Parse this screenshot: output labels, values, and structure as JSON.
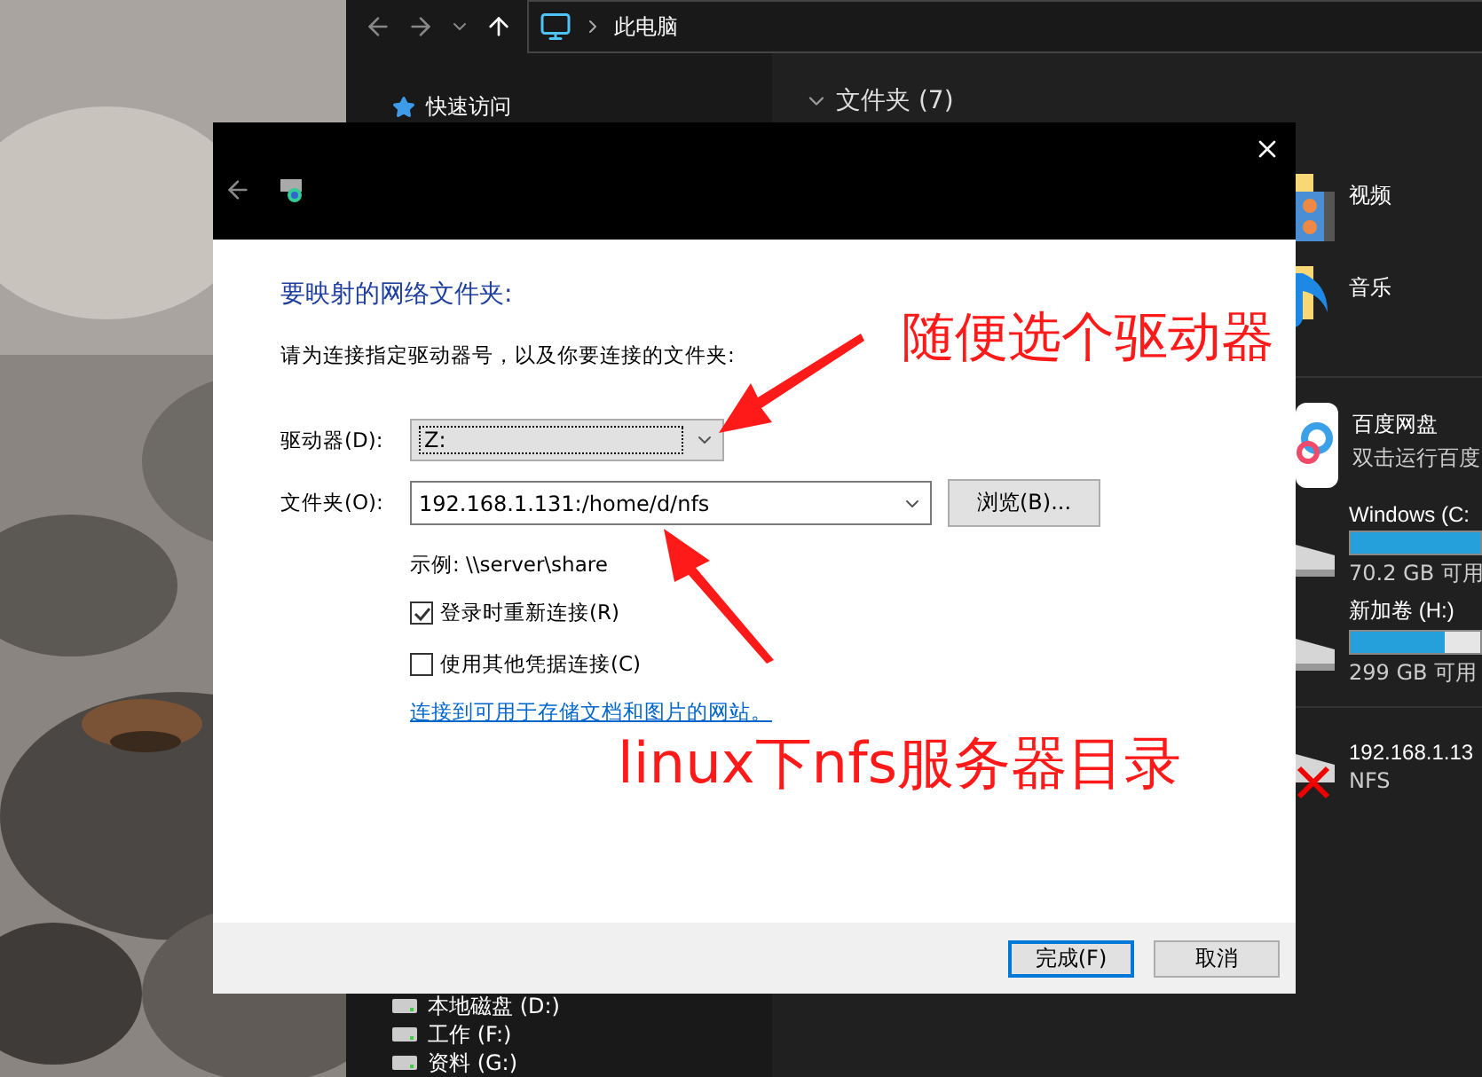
{
  "explorer": {
    "address": "此电脑",
    "nav_top": [
      {
        "label": "快速访问",
        "kind": "star"
      }
    ],
    "nav_bottom": [
      {
        "label": "本地磁盘 (D:)",
        "kind": "drive"
      },
      {
        "label": "工作 (F:)",
        "kind": "drive"
      },
      {
        "label": "资料 (G:)",
        "kind": "drive"
      }
    ],
    "section_header": "文件夹 (7)",
    "items": [
      {
        "kind": "video",
        "name": "视频"
      },
      {
        "kind": "music",
        "name": "音乐"
      },
      {
        "kind": "divider"
      },
      {
        "kind": "app",
        "name": "百度网盘",
        "detail": "双击运行百度"
      },
      {
        "kind": "disk",
        "name": "Windows (C:",
        "level": 1,
        "detail": "70.2 GB 可用"
      },
      {
        "kind": "disk",
        "name": "新加卷 (H:)",
        "level": 0.73,
        "detail": "299 GB 可用"
      },
      {
        "kind": "divider"
      },
      {
        "kind": "network",
        "name": "192.168.1.13",
        "detail": "NFS"
      }
    ]
  },
  "dialog": {
    "heading": "要映射的网络文件夹:",
    "instruction": "请为连接指定驱动器号，以及你要连接的文件夹:",
    "drive": {
      "label": "驱动器(D):",
      "value": "Z:"
    },
    "folder": {
      "label": "文件夹(O):",
      "value": "192.168.1.131:/home/d/nfs"
    },
    "browse_button": "浏览(B)...",
    "example": "示例: \\\\server\\share",
    "options": [
      {
        "label": "登录时重新连接(R)",
        "checked": true
      },
      {
        "label": "使用其他凭据连接(C)",
        "checked": false
      }
    ],
    "link": "连接到可用于存储文档和图片的网站。",
    "buttons": [
      {
        "label": "完成(F)",
        "default": true
      },
      {
        "label": "取消",
        "default": false
      }
    ]
  },
  "annotations": [
    {
      "text": "随便选个驱动器"
    },
    {
      "text": "linux下nfs服务器目录"
    }
  ]
}
